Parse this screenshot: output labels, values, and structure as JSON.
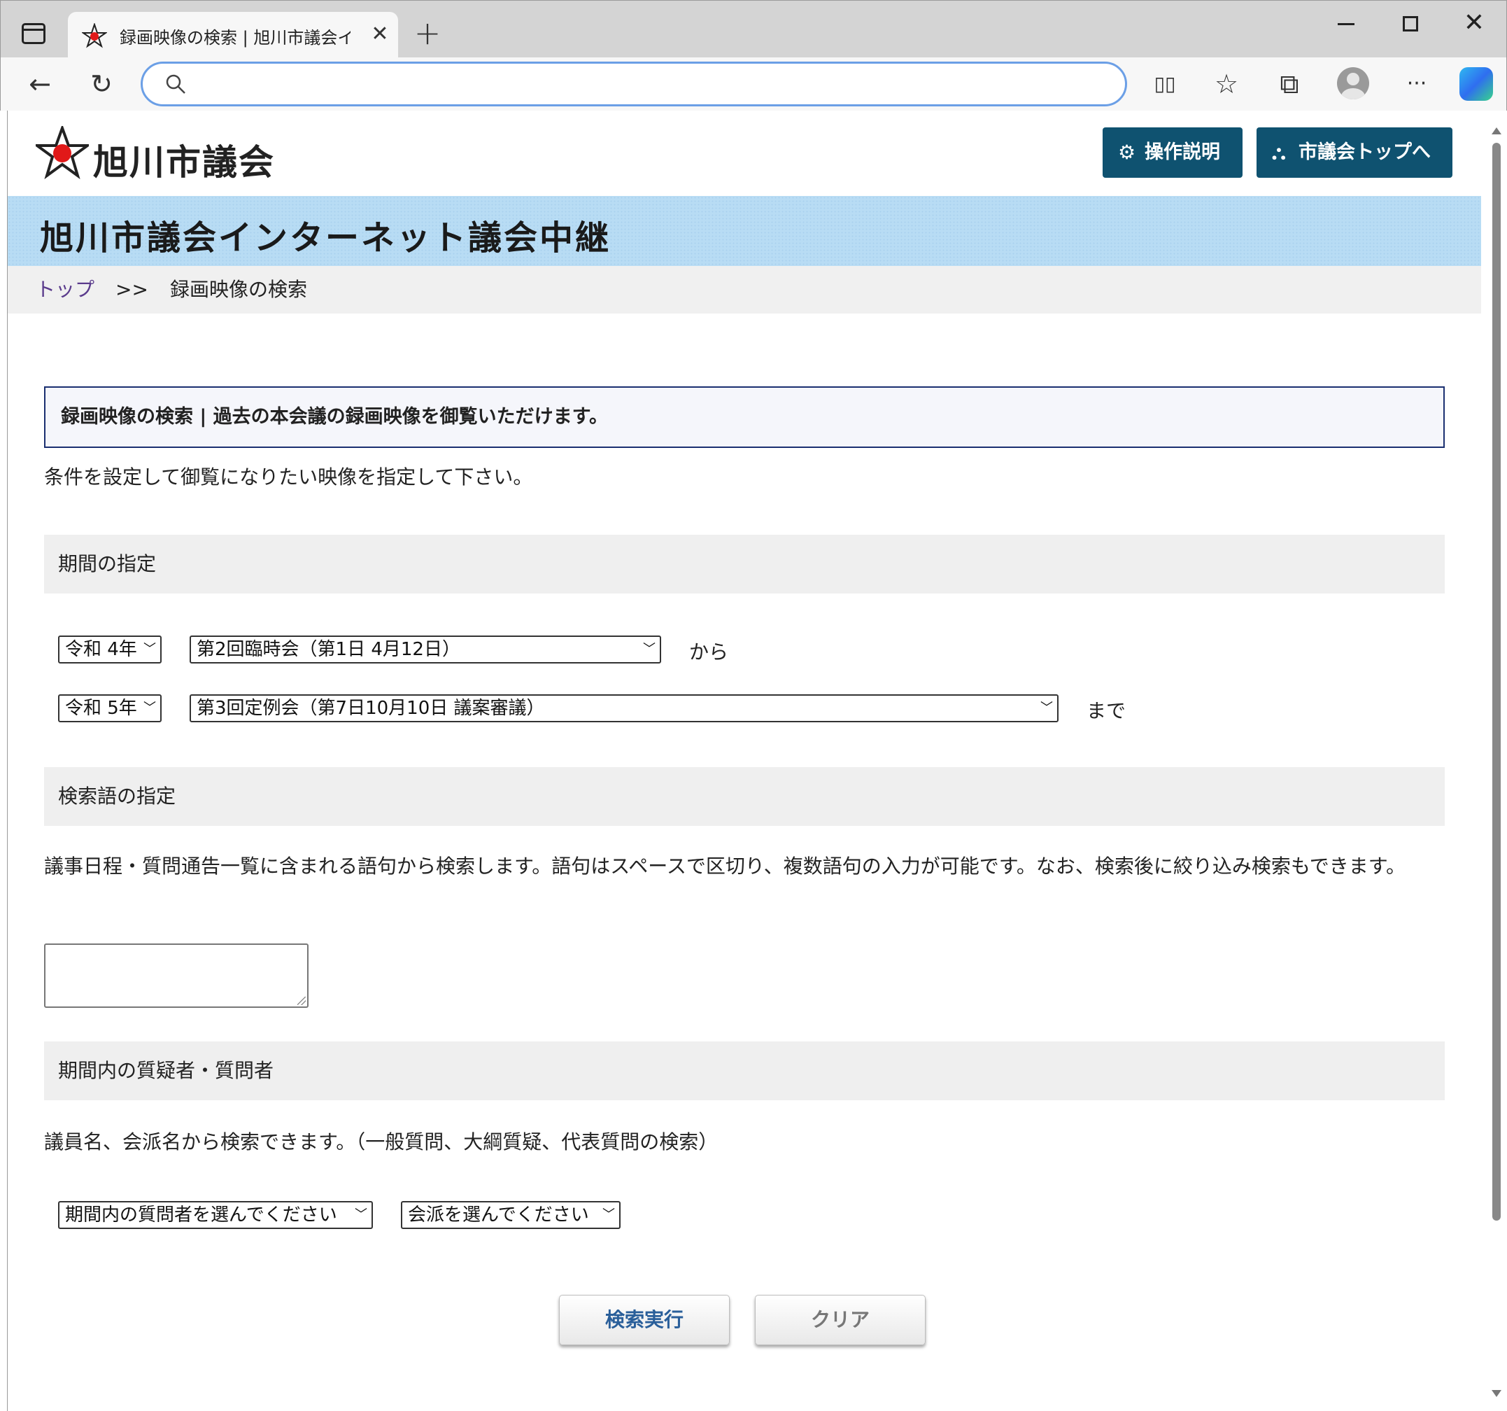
{
  "browser": {
    "tab_title": "録画映像の検索 | 旭川市議会インターネット議会中継",
    "tab_close": "✕",
    "new_tab": "+",
    "address_value": "",
    "minimize_label": "",
    "close_label": "✕",
    "icons": {
      "back": "←",
      "refresh": "↻",
      "split_screen": "▯▯",
      "favorites": "☆",
      "collections": "⧉",
      "more": "···"
    }
  },
  "header": {
    "logo_text": "旭川市議会",
    "help_button": "操作説明",
    "top_button": "市議会トップへ",
    "help_icon": "⚙",
    "top_icon": "⛬"
  },
  "banner": {
    "title": "旭川市議会インターネット議会中継"
  },
  "breadcrumb": {
    "home": "トップ",
    "separator": ">>",
    "current": "録画映像の検索"
  },
  "main": {
    "title_box": "録画映像の検索 | 過去の本会議の録画映像を御覧いただけます。",
    "intro": "条件を設定して御覧になりたい映像を指定して下さい。",
    "period": {
      "heading": "期間の指定",
      "from_year": "令和 4年",
      "from_session": "第2回臨時会（第1日 4月12日）",
      "from_label": "から",
      "to_year": "令和 5年",
      "to_session": "第3回定例会（第7日10月10日 議案審議）",
      "to_label": "まで"
    },
    "keyword": {
      "heading": "検索語の指定",
      "description": "議事日程・質問通告一覧に含まれる語句から検索します。語句はスペースで区切り、複数語句の入力が可能です。なお、検索後に絞り込み検索もできます。",
      "value": ""
    },
    "questioner": {
      "heading": "期間内の質疑者・質問者",
      "description": "議員名、会派名から検索できます。（一般質問、大綱質疑、代表質問の検索）",
      "member_select": "期間内の質問者を選んでください",
      "faction_select": "会派を選んでください"
    },
    "buttons": {
      "search": "検索実行",
      "clear": "クリア"
    }
  },
  "colors": {
    "header_button": "#0f5270",
    "banner": "#b8dcf4",
    "title_border": "#1a2f70",
    "section_bg": "#efefef",
    "breadcrumb_link": "#5a3b8c",
    "logo_red": "#e11919"
  }
}
